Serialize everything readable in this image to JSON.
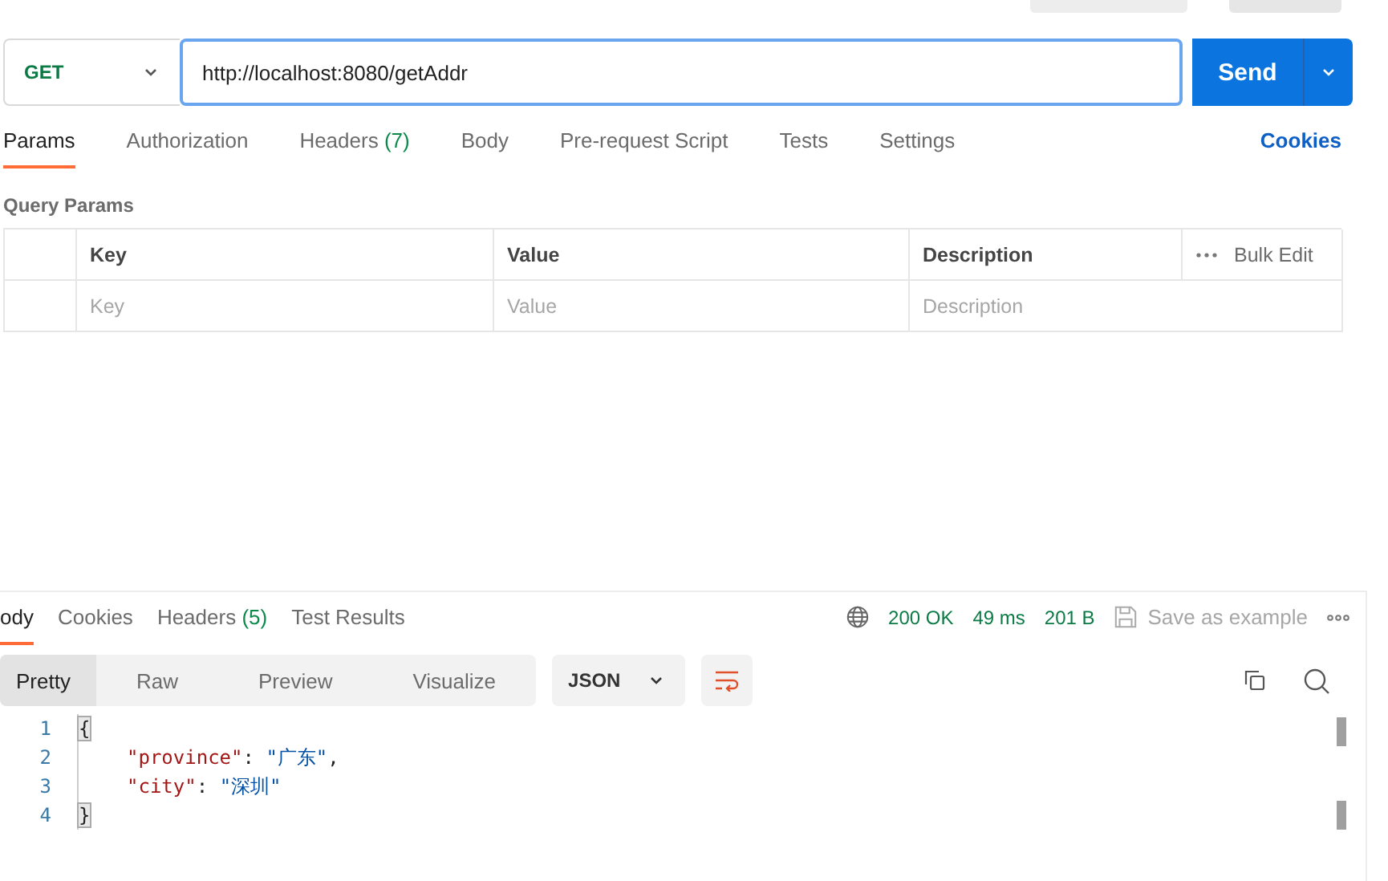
{
  "request": {
    "method": "GET",
    "url": "http://localhost:8080/getAddr",
    "send": "Send"
  },
  "request_tabs": [
    {
      "label": "Params",
      "selected": true
    },
    {
      "label": "Authorization",
      "selected": false
    },
    {
      "label": "Headers",
      "count": "(7)",
      "selected": false
    },
    {
      "label": "Body",
      "selected": false
    },
    {
      "label": "Pre-request Script",
      "selected": false
    },
    {
      "label": "Tests",
      "selected": false
    },
    {
      "label": "Settings",
      "selected": false
    }
  ],
  "cookies_link": "Cookies",
  "query_params": {
    "title": "Query Params",
    "columns": [
      "Key",
      "Value",
      "Description"
    ],
    "bulk_edit": "Bulk Edit",
    "placeholders": [
      "Key",
      "Value",
      "Description"
    ]
  },
  "response": {
    "tabs": [
      {
        "label": "ody",
        "selected": true
      },
      {
        "label": "Cookies",
        "selected": false
      },
      {
        "label": "Headers",
        "count": "(5)",
        "selected": false
      },
      {
        "label": "Test Results",
        "selected": false
      }
    ],
    "status": "200 OK",
    "time": "49 ms",
    "size": "201 B",
    "save": "Save as example",
    "views": [
      {
        "label": "Pretty",
        "selected": true
      },
      {
        "label": "Raw",
        "selected": false
      },
      {
        "label": "Preview",
        "selected": false
      },
      {
        "label": "Visualize",
        "selected": false
      }
    ],
    "format": "JSON",
    "lines": [
      {
        "number": "1",
        "indent": false,
        "tokens": [
          {
            "kind": "fold",
            "text": "{"
          }
        ]
      },
      {
        "number": "2",
        "indent": true,
        "tokens": [
          {
            "kind": "key",
            "text": "\"province\""
          },
          {
            "kind": "punct",
            "text": ": "
          },
          {
            "kind": "string",
            "text": "\"广东\""
          },
          {
            "kind": "punct",
            "text": ","
          }
        ]
      },
      {
        "number": "3",
        "indent": true,
        "tokens": [
          {
            "kind": "key",
            "text": "\"city\""
          },
          {
            "kind": "punct",
            "text": ": "
          },
          {
            "kind": "string",
            "text": "\"深圳\""
          }
        ]
      },
      {
        "number": "4",
        "indent": false,
        "tokens": [
          {
            "kind": "fold",
            "text": "}"
          }
        ]
      }
    ]
  }
}
